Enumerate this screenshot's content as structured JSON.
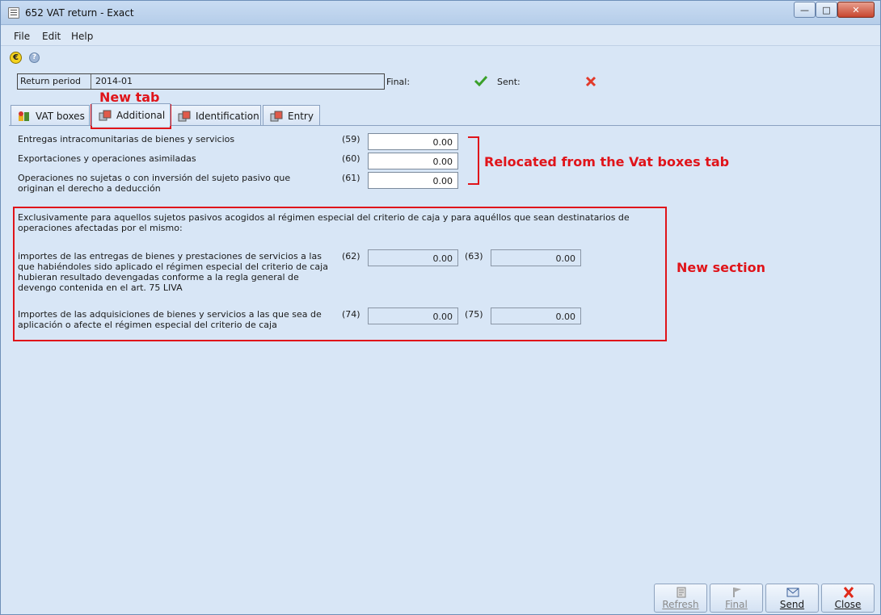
{
  "window": {
    "title": "652 VAT return - Exact",
    "min_icon": "minimize-icon",
    "max_icon": "maximize-icon",
    "close_icon": "close-icon"
  },
  "menu": {
    "items": [
      "File",
      "Edit",
      "Help"
    ]
  },
  "toolbar": {
    "icons": [
      "euro-icon",
      "help-icon"
    ]
  },
  "header": {
    "return_period_label": "Return period",
    "return_period_value": "2014-01",
    "final_label": "Final:",
    "final_status": "checked",
    "sent_label": "Sent:",
    "sent_status": "not-sent"
  },
  "tabs": [
    {
      "label": "VAT boxes",
      "icon": "vat-boxes-icon"
    },
    {
      "label": "Additional",
      "icon": "additional-icon",
      "active": true
    },
    {
      "label": "Identification",
      "icon": "identification-icon"
    },
    {
      "label": "Entry",
      "icon": "entry-icon"
    }
  ],
  "rows": [
    {
      "label": "Entregas intracomunitarias de bienes y servicios",
      "code": "(59)",
      "value": "0.00"
    },
    {
      "label": "Exportaciones y operaciones asimiladas",
      "code": "(60)",
      "value": "0.00"
    },
    {
      "label": "Operaciones no sujetas o con inversión del sujeto pasivo que originan el derecho a deducción",
      "code": "(61)",
      "value": "0.00"
    }
  ],
  "section": {
    "intro": "Exclusivamente para aquellos sujetos pasivos acogidos al régimen especial del criterio de caja y para aquéllos que sean destinatarios de operaciones afectadas por el mismo:",
    "rows": [
      {
        "label": "importes de las entregas de bienes y prestaciones de servicios a las que habiéndoles sido aplicado el régimen especial del criterio de caja hubieran resultado devengadas conforme a la regla general de devengo contenida en el art. 75 LIVA",
        "code1": "(62)",
        "value1": "0.00",
        "code2": "(63)",
        "value2": "0.00"
      },
      {
        "label": "Importes de las adquisiciones de bienes y servicios a las que sea de aplicación o afecte el régimen especial del criterio de caja",
        "code1": "(74)",
        "value1": "0.00",
        "code2": "(75)",
        "value2": "0.00"
      }
    ]
  },
  "annotations": {
    "new_tab": "New tab",
    "relocated": "Relocated from the Vat boxes tab",
    "new_section": "New section",
    "color": "#e0141a"
  },
  "buttons": [
    {
      "label": "Refresh",
      "icon": "refresh-icon",
      "enabled": false
    },
    {
      "label": "Final",
      "icon": "final-flag-icon",
      "enabled": false
    },
    {
      "label": "Send",
      "icon": "send-icon",
      "enabled": true
    },
    {
      "label": "Close",
      "icon": "close-x-icon",
      "enabled": true
    }
  ]
}
